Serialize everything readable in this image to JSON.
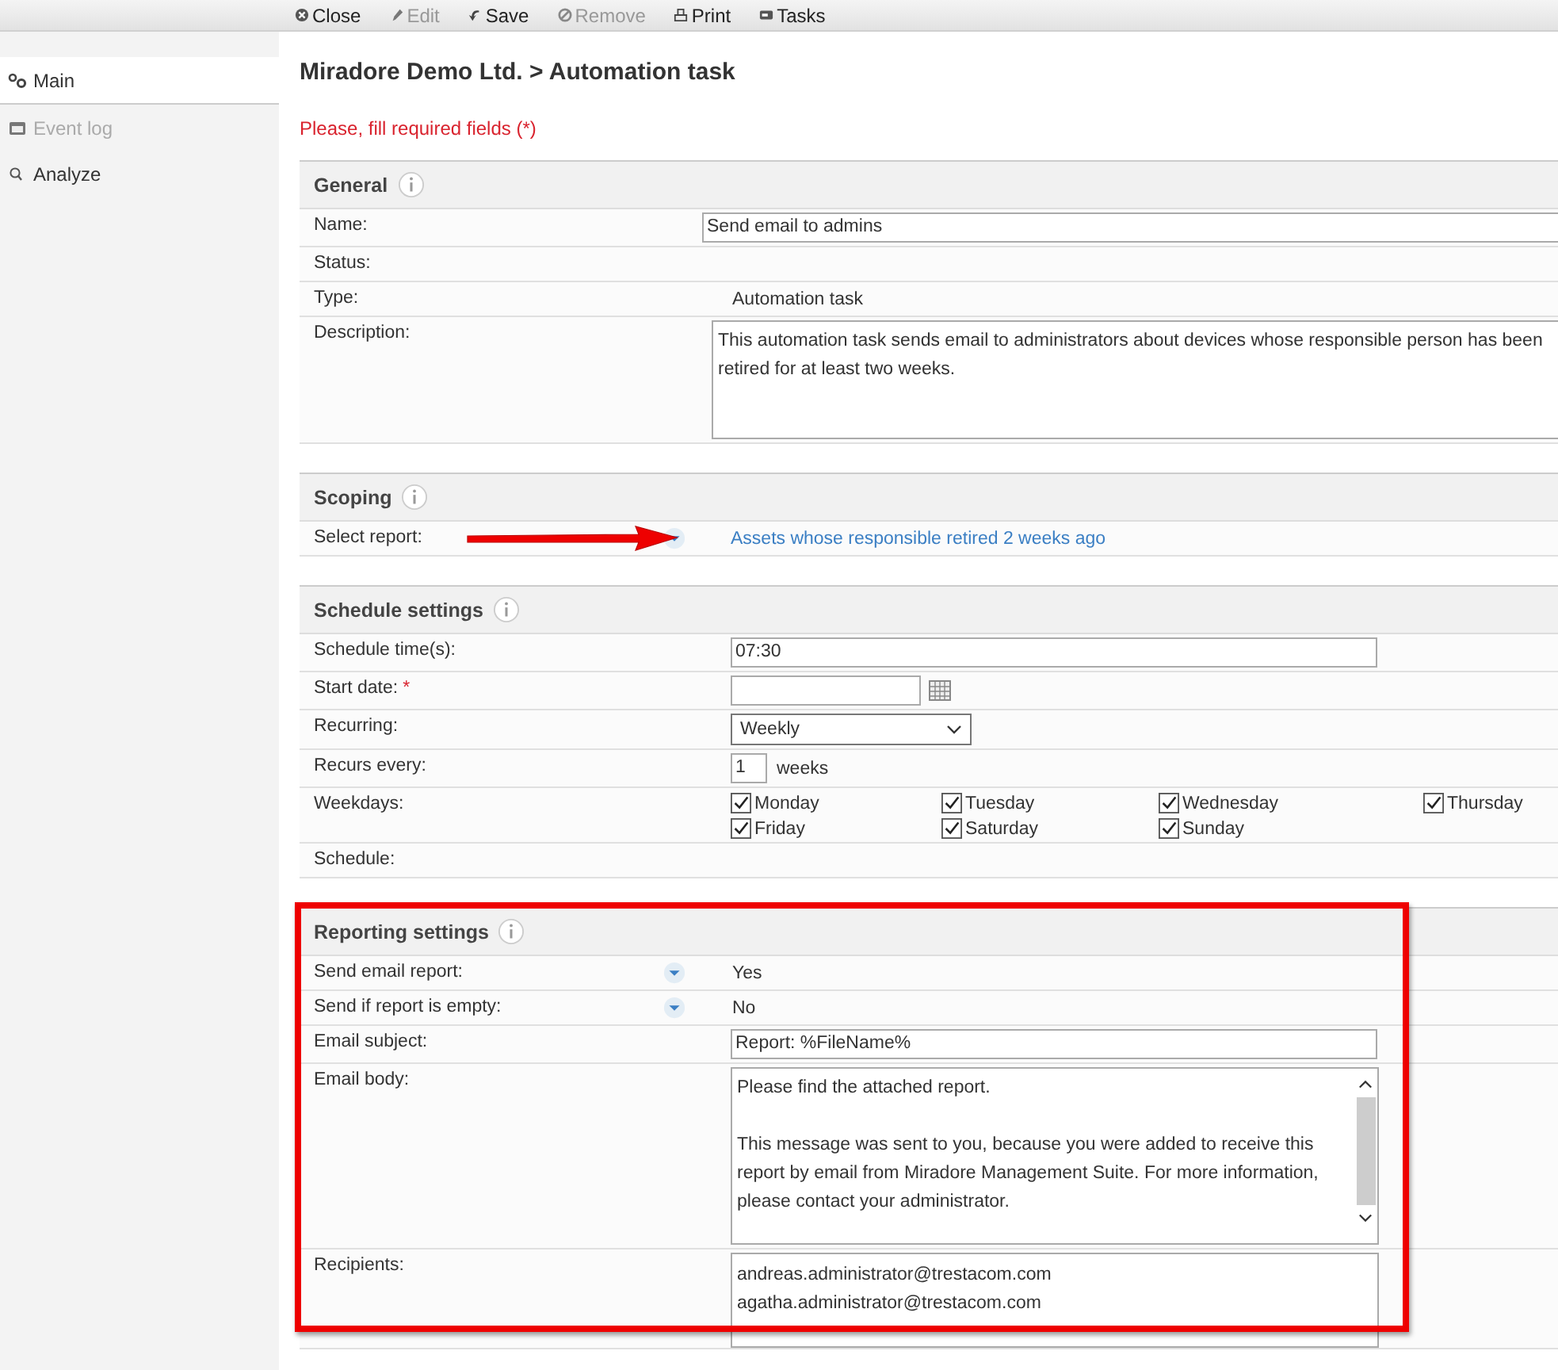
{
  "toolbar": [
    {
      "label": "Close",
      "disabled": false
    },
    {
      "label": "Edit",
      "disabled": true
    },
    {
      "label": "Save",
      "disabled": false
    },
    {
      "label": "Remove",
      "disabled": true
    },
    {
      "label": "Print",
      "disabled": false
    },
    {
      "label": "Tasks",
      "disabled": false
    }
  ],
  "sidebar": {
    "items": [
      {
        "label": "Main",
        "selected": true,
        "disabled": false
      },
      {
        "label": "Event log",
        "selected": false,
        "disabled": true
      },
      {
        "label": "Analyze",
        "selected": false,
        "disabled": false
      }
    ]
  },
  "breadcrumb": "Miradore Demo Ltd. > Automation task",
  "validation_message": "Please, fill required fields (*)",
  "sections": [
    {
      "title": "General",
      "highlighted": false,
      "rows": [
        {
          "kind": "wide-field",
          "label": "Name:",
          "value": "Send email to admins"
        },
        {
          "kind": "empty",
          "label": "Status:"
        },
        {
          "kind": "text",
          "label": "Type:",
          "value": "Automation task"
        },
        {
          "kind": "wide-area",
          "label": "Description:",
          "value": "This automation task sends email to administrators about devices whose responsible person has been retired for at least two weeks."
        }
      ]
    },
    {
      "title": "Scoping",
      "highlighted": false,
      "rows": [
        {
          "kind": "picker-link",
          "label": "Select report:",
          "value": "Assets whose responsible retired 2 weeks ago",
          "annotated": true
        }
      ]
    },
    {
      "title": "Schedule settings",
      "highlighted": false,
      "rows": [
        {
          "kind": "field",
          "label": "Schedule time(s):",
          "value": "07:30"
        },
        {
          "kind": "date",
          "label": "Start date:",
          "required_mark": "*"
        },
        {
          "kind": "select",
          "label": "Recurring:",
          "value": "Weekly"
        },
        {
          "kind": "number",
          "label": "Recurs every:",
          "value": "1",
          "unit": "weeks"
        },
        {
          "kind": "checkboxes",
          "label": "Weekdays:",
          "options": [
            {
              "label": "Monday",
              "checked": true
            },
            {
              "label": "Tuesday",
              "checked": true
            },
            {
              "label": "Wednesday",
              "checked": true
            },
            {
              "label": "Thursday",
              "checked": true
            },
            {
              "label": "Friday",
              "checked": true
            },
            {
              "label": "Saturday",
              "checked": true
            },
            {
              "label": "Sunday",
              "checked": true
            }
          ]
        },
        {
          "kind": "empty",
          "label": "Schedule:"
        }
      ]
    },
    {
      "title": "Reporting settings",
      "highlighted": true,
      "rows": [
        {
          "kind": "picker-text",
          "label": "Send email report:",
          "value": "Yes"
        },
        {
          "kind": "picker-text",
          "label": "Send if report is empty:",
          "value": "No"
        },
        {
          "kind": "field",
          "label": "Email subject:",
          "value": "Report: %FileName%"
        },
        {
          "kind": "scroll-area",
          "label": "Email body:",
          "value": "Please find the attached report.\n\nThis message was sent to you, because you were added to receive this report by email from Miradore Management Suite. For more information, please contact your administrator."
        },
        {
          "kind": "list-area",
          "label": "Recipients:",
          "lines": [
            "andreas.administrator@trestacom.com",
            "agatha.administrator@trestacom.com"
          ]
        }
      ]
    }
  ]
}
